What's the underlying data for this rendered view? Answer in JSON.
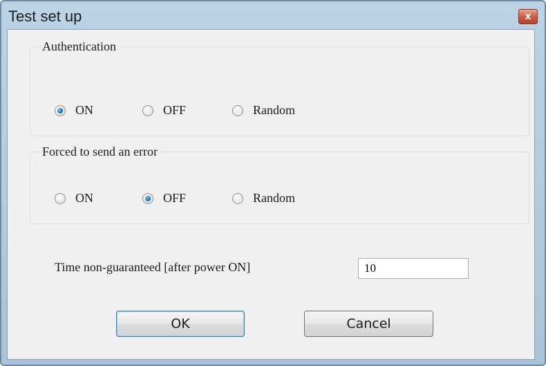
{
  "window": {
    "title": "Test set up",
    "close_glyph": "x"
  },
  "authentication": {
    "legend": "Authentication",
    "options": [
      {
        "label": "ON",
        "selected": true
      },
      {
        "label": "OFF",
        "selected": false
      },
      {
        "label": "Random",
        "selected": false
      }
    ]
  },
  "forced_error": {
    "legend": "Forced to send an error",
    "options": [
      {
        "label": "ON",
        "selected": false
      },
      {
        "label": "OFF",
        "selected": true
      },
      {
        "label": "Random",
        "selected": false
      }
    ]
  },
  "time_non_guaranteed": {
    "label": "Time non-guaranteed [after power ON]",
    "value": "10"
  },
  "buttons": {
    "ok_label": "OK",
    "cancel_label": "Cancel"
  },
  "colors": {
    "titlebar": "#b9d1e4",
    "close_button": "#c9503a",
    "radio_selected": "#1f6fb5",
    "dialog_body": "#f0f0f0"
  }
}
